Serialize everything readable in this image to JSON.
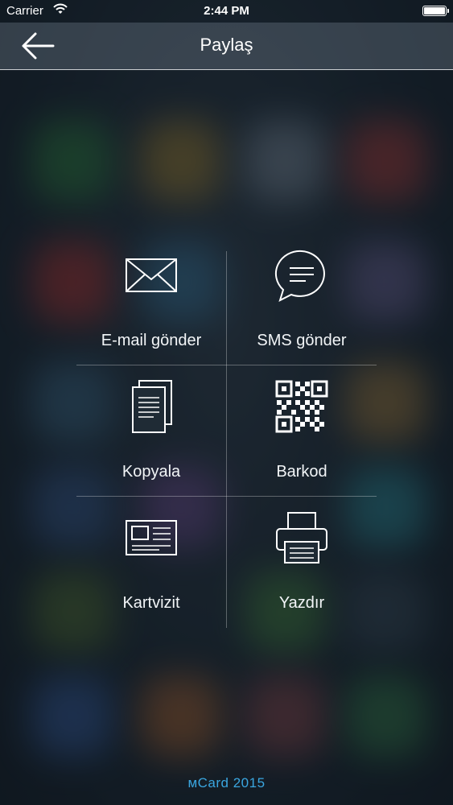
{
  "status_bar": {
    "carrier": "Carrier",
    "time": "2:44 PM"
  },
  "nav": {
    "title": "Paylaş"
  },
  "share_options": [
    {
      "label": "E-mail gönder",
      "icon": "envelope-icon"
    },
    {
      "label": "SMS gönder",
      "icon": "chat-bubble-icon"
    },
    {
      "label": "Kopyala",
      "icon": "copy-documents-icon"
    },
    {
      "label": "Barkod",
      "icon": "qr-code-icon"
    },
    {
      "label": "Kartvizit",
      "icon": "business-card-icon"
    },
    {
      "label": "Yazdır",
      "icon": "printer-icon"
    }
  ],
  "footer": {
    "text": "мCard 2015"
  },
  "colors": {
    "accent": "#3aa6e0",
    "navbar": "#7d8a96"
  }
}
